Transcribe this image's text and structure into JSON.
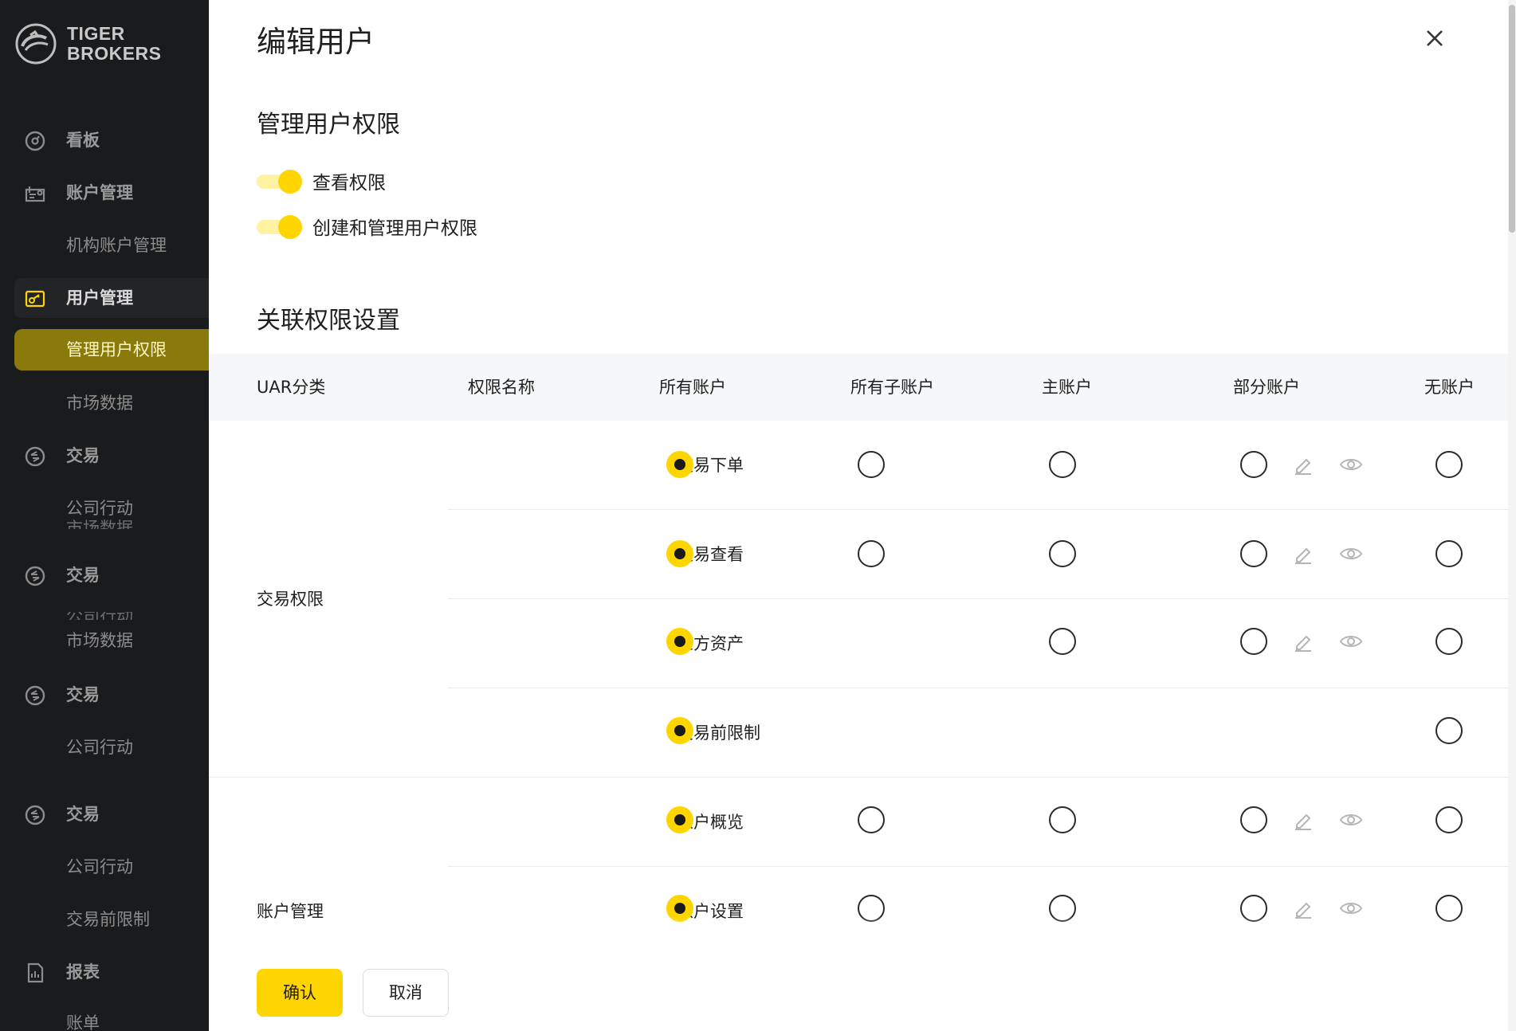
{
  "brand": {
    "line1": "TIGER",
    "line2": "BROKERS"
  },
  "sidebar": {
    "items": [
      {
        "label": "看板",
        "icon": "dashboard-icon"
      },
      {
        "label": "账户管理",
        "icon": "account-icon"
      },
      {
        "label": "机构账户管理"
      },
      {
        "label": "用户管理",
        "icon": "user-manage-icon"
      },
      {
        "label": "管理用户权限"
      },
      {
        "label": "市场数据"
      },
      {
        "label": "交易",
        "icon": "trade-icon"
      },
      {
        "label": "公司行动"
      },
      {
        "label": "交易",
        "icon": "trade-icon"
      },
      {
        "label": "市场数据"
      },
      {
        "label": "交易",
        "icon": "trade-icon"
      },
      {
        "label": "公司行动"
      },
      {
        "label": "交易",
        "icon": "trade-icon"
      },
      {
        "label": "公司行动"
      },
      {
        "label": "交易前限制"
      },
      {
        "label": "报表",
        "icon": "report-icon"
      },
      {
        "label": "账单"
      }
    ],
    "ghost_text": [
      "市场数据",
      "公司行动"
    ]
  },
  "dialog": {
    "title": "编辑用户",
    "section1": "管理用户权限",
    "toggles": [
      {
        "label": "查看权限",
        "on": true
      },
      {
        "label": "创建和管理用户权限",
        "on": true
      }
    ],
    "section2": "关联权限设置"
  },
  "table": {
    "headers": [
      "UAR分类",
      "权限名称",
      "所有账户",
      "所有子账户",
      "主账户",
      "部分账户",
      "无账户"
    ],
    "categories": [
      "交易权限",
      "账户管理"
    ],
    "rows": [
      {
        "name": "交易下单",
        "all": true,
        "sub": true,
        "main": true,
        "partial": true,
        "none": true
      },
      {
        "name": "交易查看",
        "all": true,
        "sub": true,
        "main": true,
        "partial": true,
        "none": true
      },
      {
        "name": "三方资产",
        "all": true,
        "sub": false,
        "main": true,
        "partial": true,
        "none": true
      },
      {
        "name": "交易前限制",
        "all": true,
        "sub": false,
        "main": false,
        "partial": false,
        "none": true
      },
      {
        "name": "账户概览",
        "all": true,
        "sub": true,
        "main": true,
        "partial": true,
        "none": true
      },
      {
        "name": "账户设置",
        "all": true,
        "sub": true,
        "main": true,
        "partial": true,
        "none": true
      }
    ],
    "selected_column": "所有账户"
  },
  "footer": {
    "confirm": "确认",
    "cancel": "取消"
  },
  "colors": {
    "accent": "#ffd500",
    "sidebar_bg": "#1a1b1d",
    "active_nav": "#8a7a0c"
  }
}
